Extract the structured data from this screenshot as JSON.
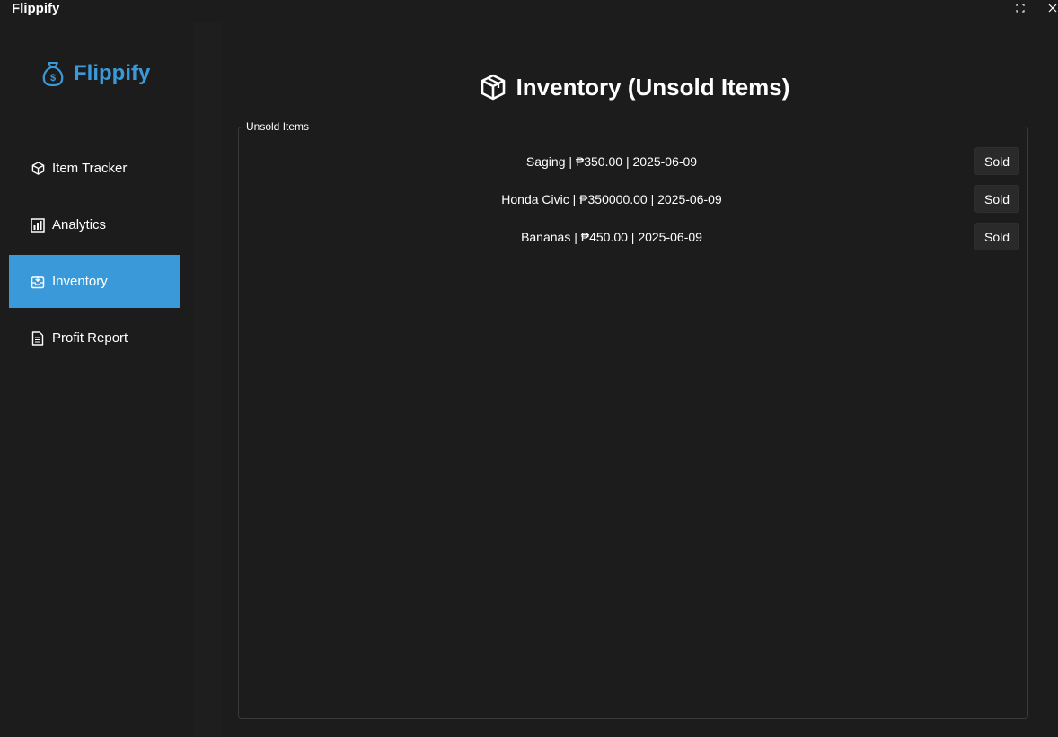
{
  "window": {
    "title": "Flippify",
    "maximize_icon": "maximize-icon",
    "close_icon": "close-icon"
  },
  "sidebar": {
    "brand": {
      "icon": "money-bag-icon",
      "name": "Flippify",
      "color": "#3a9ad9"
    },
    "items": [
      {
        "label": "Item Tracker",
        "icon": "box-icon",
        "active": false
      },
      {
        "label": "Analytics",
        "icon": "bar-chart-icon",
        "active": false
      },
      {
        "label": "Inventory",
        "icon": "inbox-icon",
        "active": true
      },
      {
        "label": "Profit Report",
        "icon": "document-icon",
        "active": false
      }
    ],
    "active_color": "#3a9ad9"
  },
  "main": {
    "heading": {
      "icon": "box-icon",
      "text": "Inventory (Unsold Items)"
    },
    "group": {
      "legend": "Unsold Items",
      "rows": [
        {
          "text": "Saging | ₱350.00 | 2025-06-09",
          "button": "Sold"
        },
        {
          "text": "Honda Civic | ₱350000.00 | 2025-06-09",
          "button": "Sold"
        },
        {
          "text": "Bananas | ₱450.00 | 2025-06-09",
          "button": "Sold"
        }
      ]
    }
  }
}
